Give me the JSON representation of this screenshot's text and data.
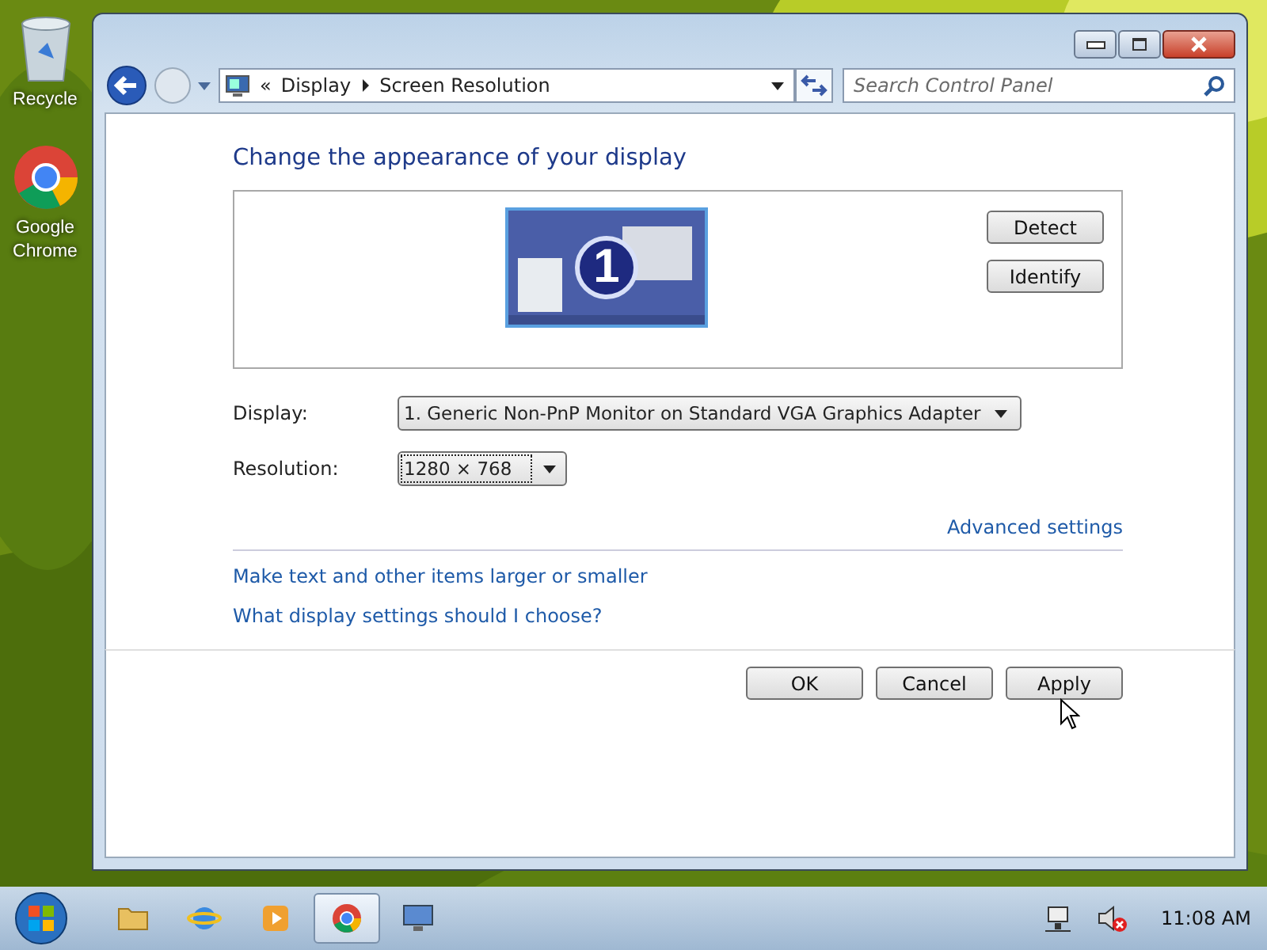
{
  "desktop_icons": [
    {
      "kind": "recycle",
      "label": "Recycle"
    },
    {
      "kind": "chrome",
      "label": "Google Chrome"
    }
  ],
  "window": {
    "nav": {
      "chevron": "«",
      "breadcrumb": [
        "Display",
        "Screen Resolution"
      ]
    },
    "search": {
      "placeholder": "Search Control Panel"
    },
    "heading": "Change the appearance of your display",
    "monitor_number": "1",
    "side_buttons": [
      "Detect",
      "Identify"
    ],
    "fields": [
      {
        "label": "Display:",
        "value": "1. Generic Non-PnP Monitor on Standard VGA Graphics Adapter",
        "focused": false
      },
      {
        "label": "Resolution:",
        "value": "1280 × 768",
        "focused": true
      }
    ],
    "advanced_link": "Advanced settings",
    "links": [
      "Make text and other items larger or smaller",
      "What display settings should I choose?"
    ],
    "dialog_buttons": [
      "OK",
      "Cancel",
      "Apply"
    ]
  },
  "taskbar": {
    "items": [
      {
        "kind": "folder",
        "active": false
      },
      {
        "kind": "browser",
        "active": false
      },
      {
        "kind": "media",
        "active": false
      },
      {
        "kind": "chrome",
        "active": true
      },
      {
        "kind": "display",
        "active": false
      }
    ],
    "clock": "11:08 AM"
  }
}
